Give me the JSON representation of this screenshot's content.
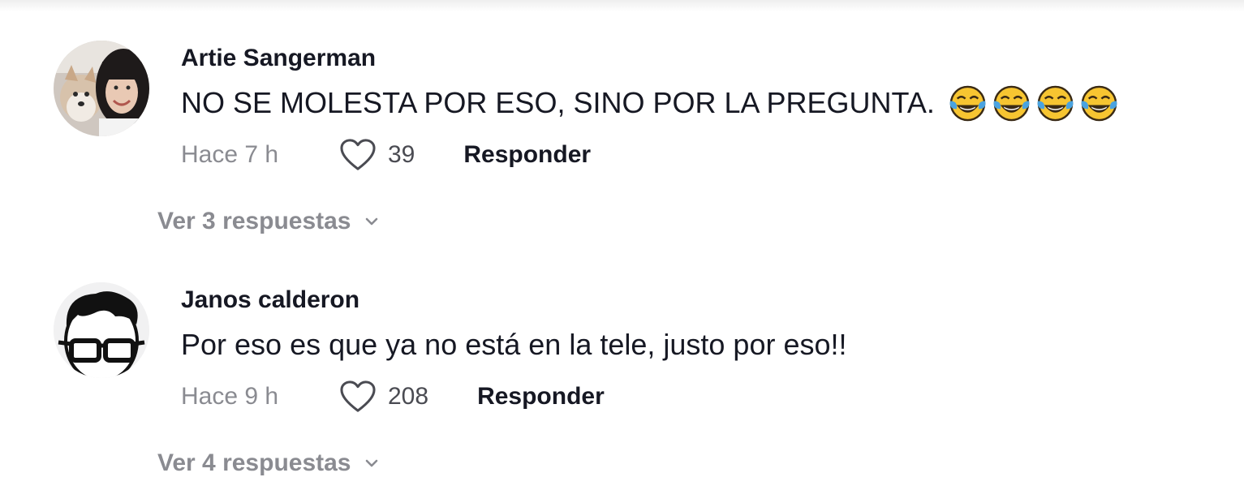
{
  "comments": [
    {
      "username": "Artie Sangerman",
      "text": "NO SE MOLESTA POR ESO, SINO POR LA PREGUNTA.",
      "emoji_icons": [
        "face-with-tears-of-joy-icon",
        "face-with-tears-of-joy-icon",
        "face-with-tears-of-joy-icon",
        "face-with-tears-of-joy-icon"
      ],
      "time": "Hace 7 h",
      "likes": "39",
      "reply_label": "Responder",
      "view_replies": "Ver 3 respuestas"
    },
    {
      "username": "Janos calderon",
      "text": "Por eso es que ya no está en la tele, justo por eso!!",
      "time": "Hace 9 h",
      "likes": "208",
      "reply_label": "Responder",
      "view_replies": "Ver 4 respuestas"
    }
  ],
  "colors": {
    "primary_text": "#161823",
    "secondary_text": "#8a8b91",
    "background": "#ffffff"
  }
}
